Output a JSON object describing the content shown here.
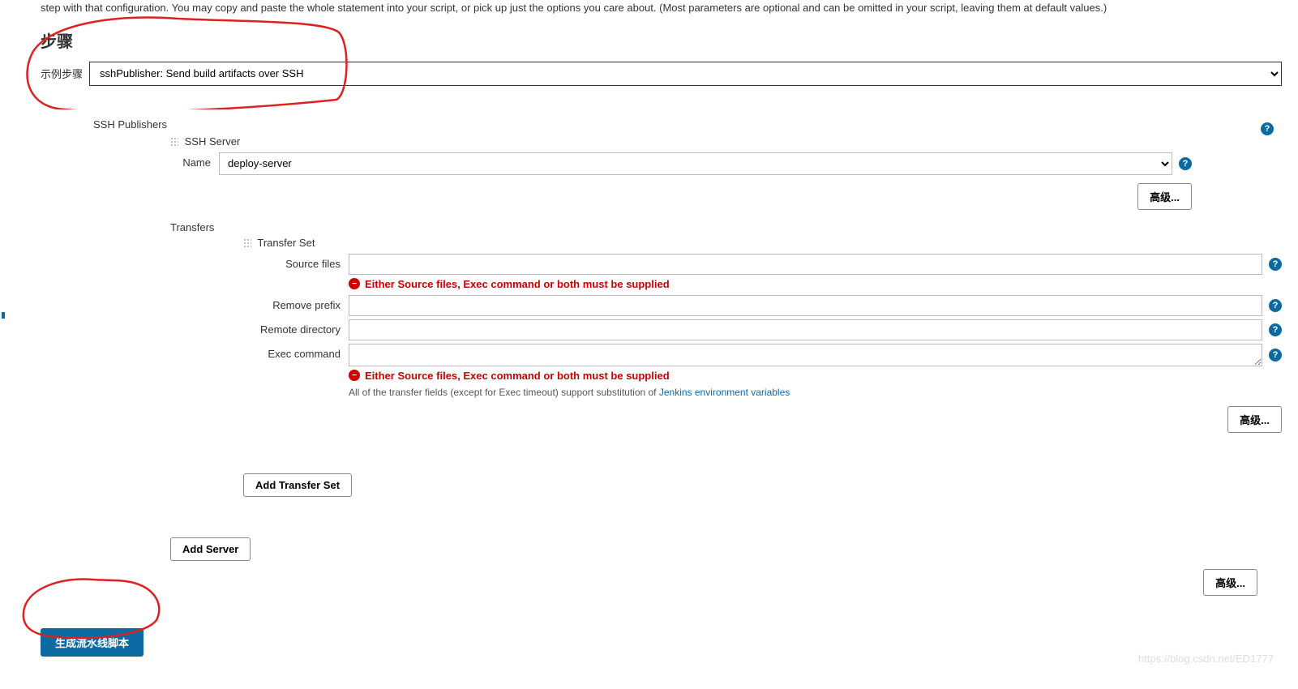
{
  "intro": "step with that configuration. You may copy and paste the whole statement into your script, or pick up just the options you care about. (Most parameters are optional and can be omitted in your script, leaving them at default values.)",
  "section_heading": "步骤",
  "step_label": "示例步骤",
  "step_value": "sshPublisher: Send build artifacts over SSH",
  "ssh_publishers_label": "SSH Publishers",
  "ssh_server_label": "SSH Server",
  "name_label": "Name",
  "name_value": "deploy-server",
  "advanced_label": "高级...",
  "transfers_label": "Transfers",
  "transfer_set_label": "Transfer Set",
  "fields": {
    "source_files": "Source files",
    "remove_prefix": "Remove prefix",
    "remote_directory": "Remote directory",
    "exec_command": "Exec command"
  },
  "error_message": "Either Source files, Exec command or both must be supplied",
  "help_text_prefix": "All of the transfer fields (except for Exec timeout) support substitution of ",
  "help_link": "Jenkins environment variables",
  "add_transfer_set": "Add Transfer Set",
  "add_server": "Add Server",
  "generate_script": "生成流水线脚本",
  "help_glyph": "?",
  "error_glyph": "−",
  "watermark": "https://blog.csdn.net/ED1777"
}
